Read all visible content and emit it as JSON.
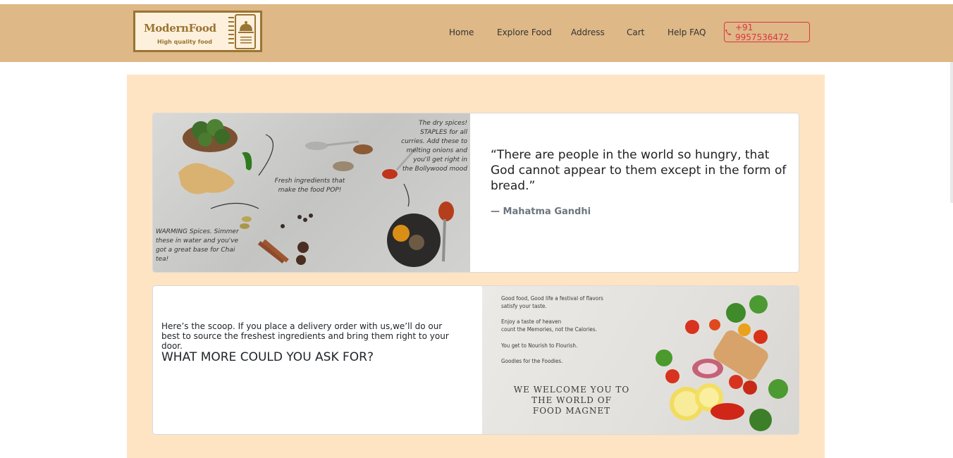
{
  "brand": {
    "name": "ModernFood",
    "tagline": "High quality food"
  },
  "nav": {
    "items": [
      "Home",
      "Explore Food",
      "Address",
      "Cart",
      "Help FAQ"
    ],
    "phone": "+91 9957536472"
  },
  "quote_card": {
    "quote": "“There are people in the world so hungry, that God cannot appear to them except in the form of bread.”",
    "author": "—  Mahatma Gandhi",
    "image": {
      "note_spices": "The dry spices! STAPLES for all curries. Add these to melting onions and you'll get right in the Bollywood mood",
      "note_fresh": "Fresh ingredients that make the food POP!",
      "note_warming": "WARMING Spices. Simmer these in water and you've got a great base for Chai tea!"
    }
  },
  "scoop_card": {
    "text": "Here’s the scoop. If you place a delivery order with us,we’ll do our best to source the freshest ingredients and bring them right to your door.",
    "heading": "WHAT MORE COULD YOU ASK FOR?",
    "image": {
      "line1": "Good food, Good life a festival of flavors",
      "line2": "satisfy your taste.",
      "line3": "Enjoy a taste of heaven",
      "line4": "count the Memories, not the Calories.",
      "line5": "You get to Nourish to Flourish.",
      "line6": "Goodies for the Foodies.",
      "welcome1": "WE WELCOME YOU TO",
      "welcome2": "THE WORLD OF",
      "welcome3": "FOOD MAGNET"
    }
  },
  "colors": {
    "navbar": "#deb887",
    "main_bg": "#ffe4c4",
    "phone": "#dc3545",
    "brand": "#9a7432"
  }
}
